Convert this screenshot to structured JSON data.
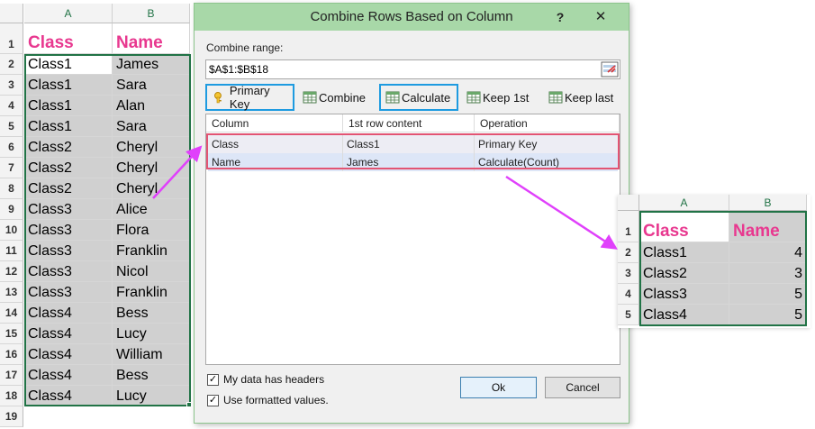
{
  "left_sheet": {
    "columns": [
      "A",
      "B"
    ],
    "row_numbers": [
      "1",
      "2",
      "3",
      "4",
      "5",
      "6",
      "7",
      "8",
      "9",
      "10",
      "11",
      "12",
      "13",
      "14",
      "15",
      "16",
      "17",
      "18",
      "19"
    ],
    "header": {
      "a": "Class",
      "b": "Name"
    },
    "rows": [
      {
        "a": "Class1",
        "b": "James"
      },
      {
        "a": "Class1",
        "b": "Sara"
      },
      {
        "a": "Class1",
        "b": "Alan"
      },
      {
        "a": "Class1",
        "b": "Sara"
      },
      {
        "a": "Class2",
        "b": "Cheryl"
      },
      {
        "a": "Class2",
        "b": "Cheryl"
      },
      {
        "a": "Class2",
        "b": "Cheryl"
      },
      {
        "a": "Class3",
        "b": "Alice"
      },
      {
        "a": "Class3",
        "b": "Flora"
      },
      {
        "a": "Class3",
        "b": "Franklin"
      },
      {
        "a": "Class3",
        "b": "Nicol"
      },
      {
        "a": "Class3",
        "b": "Franklin"
      },
      {
        "a": "Class4",
        "b": "Bess"
      },
      {
        "a": "Class4",
        "b": "Lucy"
      },
      {
        "a": "Class4",
        "b": "William"
      },
      {
        "a": "Class4",
        "b": "Bess"
      },
      {
        "a": "Class4",
        "b": "Lucy"
      }
    ],
    "header_color": "#e8388f",
    "selection_color": "#217346"
  },
  "dialog": {
    "title": "Combine Rows Based on Column",
    "help": "?",
    "close": "✕",
    "range_label": "Combine range:",
    "range_value": "$A$1:$B$18",
    "toolbar": {
      "primary_key": "Primary Key",
      "combine": "Combine",
      "calculate": "Calculate",
      "keep_first": "Keep 1st",
      "keep_last": "Keep last"
    },
    "grid": {
      "headers": [
        "Column",
        "1st row content",
        "Operation"
      ],
      "rows": [
        {
          "column": "Class",
          "first": "Class1",
          "operation": "Primary Key"
        },
        {
          "column": "Name",
          "first": "James",
          "operation": "Calculate(Count)"
        }
      ]
    },
    "options": {
      "has_headers": {
        "label": "My data has headers",
        "checked": true,
        "mark": "✓"
      },
      "formatted_values": {
        "label": "Use formatted values.",
        "checked": true,
        "mark": "✓"
      }
    },
    "ok": "Ok",
    "cancel": "Cancel"
  },
  "right_sheet": {
    "columns": [
      "A",
      "B"
    ],
    "row_numbers": [
      "1",
      "2",
      "3",
      "4",
      "5"
    ],
    "header": {
      "a": "Class",
      "b": "Name"
    },
    "rows": [
      {
        "a": "Class1",
        "b": "4"
      },
      {
        "a": "Class2",
        "b": "3"
      },
      {
        "a": "Class3",
        "b": "5"
      },
      {
        "a": "Class4",
        "b": "5"
      }
    ]
  },
  "colors": {
    "titlebar": "#a8d8a8",
    "highlight_box": "#1e9be0",
    "row_highlight": "#e25473",
    "arrow": "#e040fb"
  }
}
